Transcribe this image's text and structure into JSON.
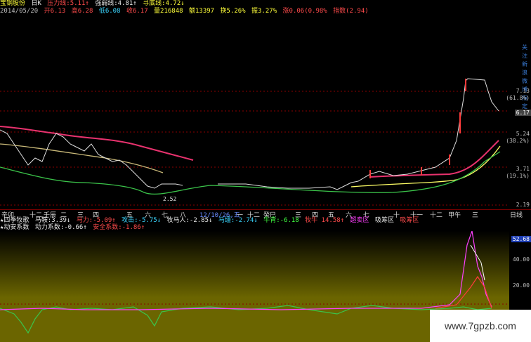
{
  "header": {
    "line1": [
      {
        "text": "宝钢股份",
        "color": "yellow"
      },
      {
        "text": "日K",
        "color": "white"
      },
      {
        "text": "压力线:5.11↑",
        "color": "red"
      },
      {
        "text": "强弱线:4.81↑",
        "color": "white"
      },
      {
        "text": "寻底线:4.72↓",
        "color": "yellow"
      }
    ],
    "line2": [
      {
        "text": "2014/05/20",
        "color": "gray"
      },
      {
        "text": "开6.13",
        "color": "red"
      },
      {
        "text": "高6.28",
        "color": "red"
      },
      {
        "text": "低6.08",
        "color": "cyan"
      },
      {
        "text": "收6.17",
        "color": "red"
      },
      {
        "text": "量216848",
        "color": "yellow"
      },
      {
        "text": "额13397",
        "color": "yellow"
      },
      {
        "text": "换5.26%",
        "color": "yellow"
      },
      {
        "text": "振3.27%",
        "color": "yellow"
      },
      {
        "text": "涨0.06(0.98%",
        "color": "red"
      },
      {
        "text": "指数(2.94)",
        "color": "red"
      }
    ]
  },
  "right_axis": {
    "labels": [
      "7.13",
      "(61.8%)",
      "5.24",
      "(38.2%)",
      "3.71",
      "(19.1%)",
      "2.19"
    ],
    "side_text": [
      "关",
      "注",
      "新",
      "浪",
      "微",
      "博",
      "指",
      "定"
    ],
    "current_price": "6.17"
  },
  "chart_labels": {
    "low_label": "2.52"
  },
  "date_bar": {
    "ticks": [
      "辛卯",
      "十二",
      "壬辰",
      "二",
      "三",
      "四",
      "五",
      "六",
      "七",
      "八",
      "12/10/26,五",
      "一",
      "十二",
      "癸巳",
      "三",
      "四",
      "五",
      "六",
      "七",
      "十",
      "十一",
      "十二",
      "甲午",
      "三",
      "日线"
    ]
  },
  "indicator1": [
    {
      "text": "★四季牧歌",
      "color": "white"
    },
    {
      "text": "马鞍:3.39↓",
      "color": "white"
    },
    {
      "text": "马力:-5.09↑",
      "color": "red"
    },
    {
      "text": "攻击:-5.75↓",
      "color": "cyan"
    },
    {
      "text": "牧马人:-2.85↓",
      "color": "white"
    },
    {
      "text": "马缰:-2.74↓",
      "color": "cyan"
    },
    {
      "text": "牛背:-6.18",
      "color": "green"
    },
    {
      "text": "牧牛 14.58↑",
      "color": "red"
    },
    {
      "text": "超卖区",
      "color": "magenta"
    },
    {
      "text": "吸筹区",
      "color": "white"
    },
    {
      "text": "吸筹区",
      "color": "red"
    }
  ],
  "indicator2": [
    {
      "text": "★动安系数",
      "color": "white"
    },
    {
      "text": "动力系数:-0.66↑",
      "color": "white"
    },
    {
      "text": "安全系数:-1.86↑",
      "color": "red"
    }
  ],
  "lower_axis": {
    "highlight": "52.68",
    "labels": [
      "40.00",
      "20.00"
    ]
  },
  "watermark": "www.7gpzb.com"
}
